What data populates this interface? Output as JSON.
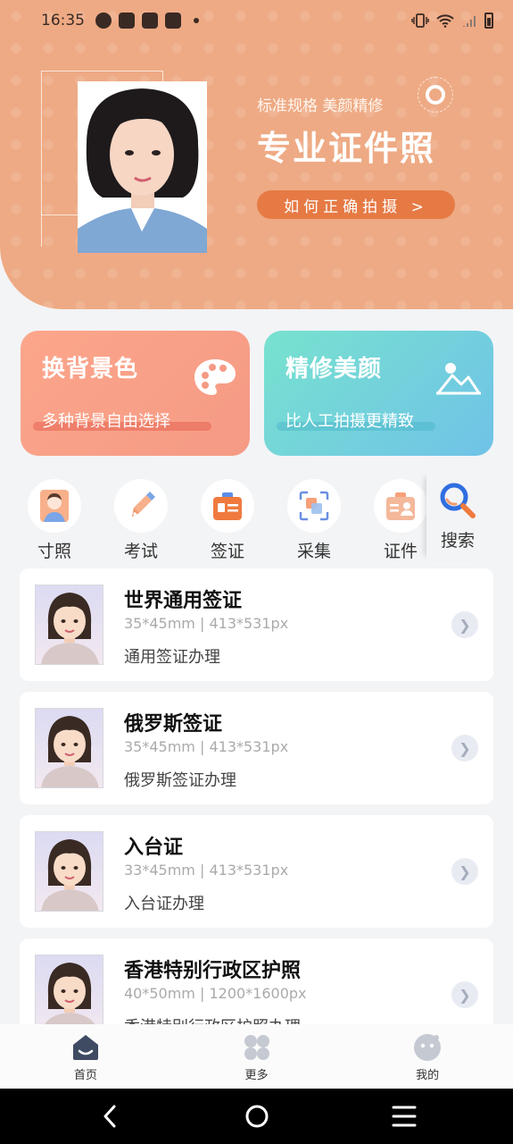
{
  "status_bar": {
    "time": "16:35"
  },
  "hero": {
    "subtitle": "标准规格 美颜精修",
    "title": "专业证件照",
    "button": "如何正确拍摄 >",
    "bg_color": "#eeaa84"
  },
  "features": [
    {
      "title": "换背景色",
      "desc": "多种背景自由选择",
      "icon": "palette-icon"
    },
    {
      "title": "精修美颜",
      "desc": "比人工拍摄更精致",
      "icon": "landscape-icon"
    }
  ],
  "categories": [
    {
      "label": "寸照",
      "icon": "portrait-icon"
    },
    {
      "label": "考试",
      "icon": "pen-icon"
    },
    {
      "label": "签证",
      "icon": "visa-icon"
    },
    {
      "label": "采集",
      "icon": "scan-icon"
    },
    {
      "label": "证件",
      "icon": "id-card-icon"
    }
  ],
  "search": {
    "label": "搜索",
    "icon": "search-icon"
  },
  "items": [
    {
      "name": "世界通用签证",
      "spec": "35*45mm | 413*531px",
      "sub": "通用签证办理"
    },
    {
      "name": "俄罗斯签证",
      "spec": "35*45mm | 413*531px",
      "sub": "俄罗斯签证办理"
    },
    {
      "name": "入台证",
      "spec": "33*45mm | 413*531px",
      "sub": "入台证办理"
    },
    {
      "name": "香港特别行政区护照",
      "spec": "40*50mm | 1200*1600px",
      "sub": "香港特别行政区护照办理"
    }
  ],
  "bottom_nav": [
    {
      "label": "首页",
      "icon": "home-icon",
      "active": true
    },
    {
      "label": "更多",
      "icon": "more-icon",
      "active": false
    },
    {
      "label": "我的",
      "icon": "profile-icon",
      "active": false
    }
  ]
}
